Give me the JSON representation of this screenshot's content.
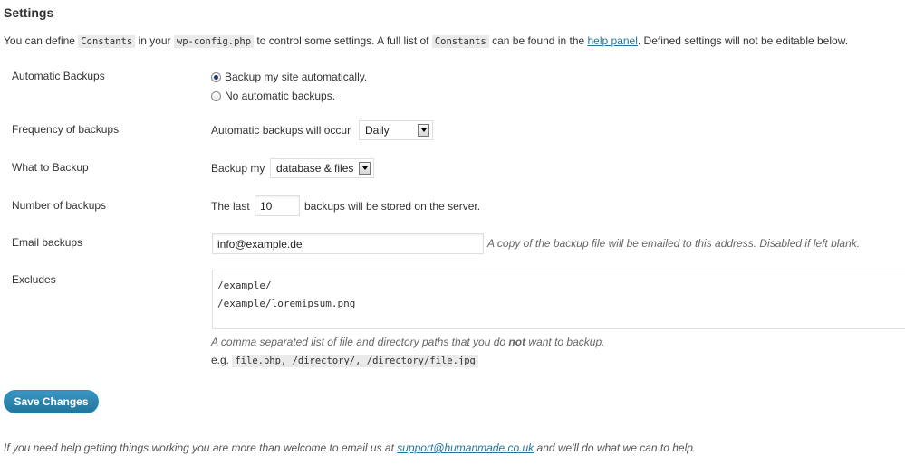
{
  "page": {
    "title": "Settings"
  },
  "intro": {
    "t1": "You can define ",
    "code1": "Constants",
    "t2": " in your ",
    "code2": "wp-config.php",
    "t3": " to control some settings. A full list of ",
    "code3": "Constants",
    "t4": " can be found in the ",
    "link": "help panel",
    "t5": ". Defined settings will not be editable below."
  },
  "automatic_backups": {
    "label": "Automatic Backups",
    "option_auto": "Backup my site automatically.",
    "option_none": "No automatic backups.",
    "selected": "auto"
  },
  "frequency": {
    "label": "Frequency of backups",
    "prefix": "Automatic backups will occur",
    "value": "Daily"
  },
  "what_to_backup": {
    "label": "What to Backup",
    "prefix": "Backup my",
    "value": "database & files"
  },
  "number_of_backups": {
    "label": "Number of backups",
    "prefix": "The last",
    "value": "10",
    "suffix": "backups will be stored on the server."
  },
  "email": {
    "label": "Email backups",
    "value": "info@example.de",
    "description": "A copy of the backup file will be emailed to this address. Disabled if left blank."
  },
  "excludes": {
    "label": "Excludes",
    "lines": [
      "/example/",
      "/example/loremipsum.png"
    ],
    "desc_before": "A comma separated list of file and directory paths that you do ",
    "desc_bold": "not",
    "desc_after": " want to backup.",
    "example_prefix": "e.g. ",
    "example_code": "file.php, /directory/, /directory/file.jpg"
  },
  "save_button": {
    "label": "Save Changes"
  },
  "footer": {
    "before": "If you need help getting things working you are more than welcome to email us at ",
    "email": "support@humanmade.co.uk",
    "after": " and we'll do what we can to help."
  },
  "colors": {
    "link": "#21759b",
    "button": "#21759b"
  }
}
